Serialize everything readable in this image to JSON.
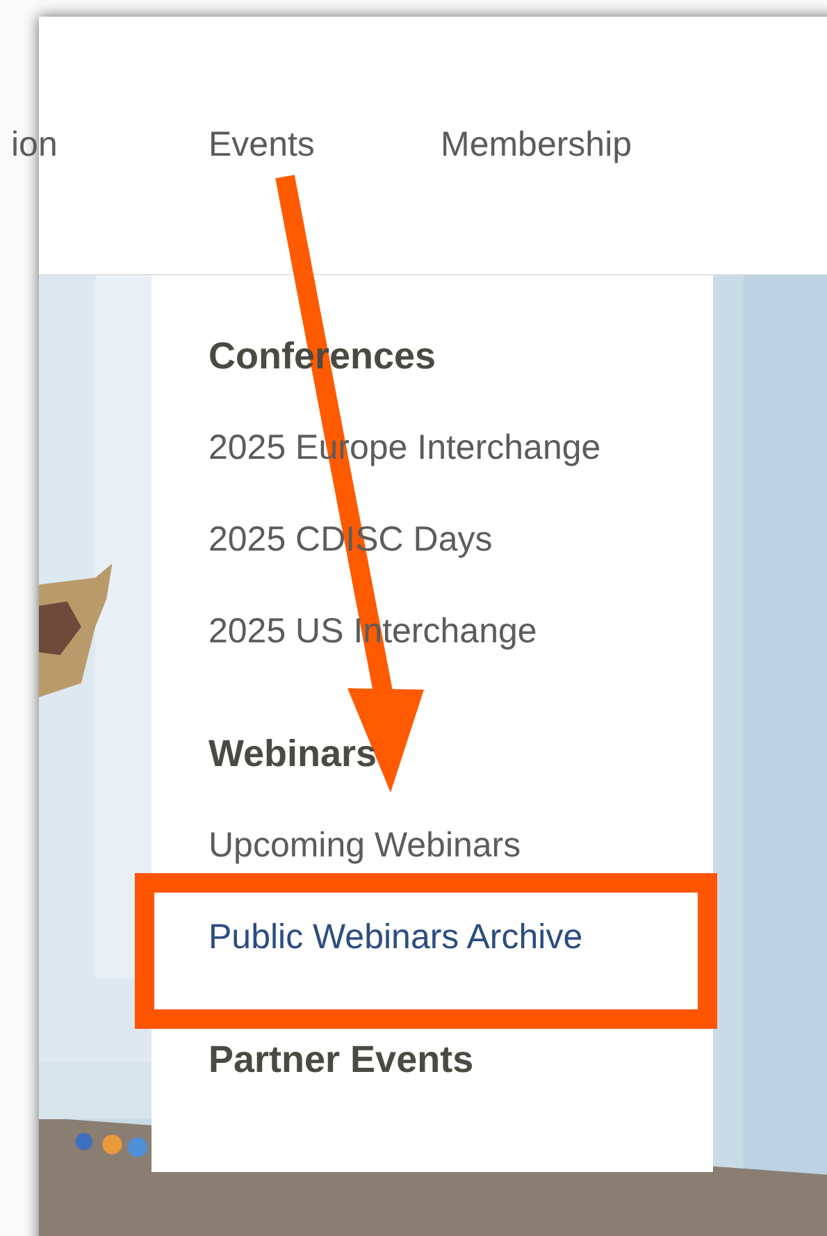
{
  "nav": {
    "items": [
      {
        "label": "ion"
      },
      {
        "label": "Events"
      },
      {
        "label": "Membership"
      }
    ]
  },
  "dropdown": {
    "groups": [
      {
        "heading": "Conferences",
        "links": [
          {
            "label": "2025 Europe Interchange",
            "selected": false
          },
          {
            "label": "2025 CDISC Days",
            "selected": false
          },
          {
            "label": "2025 US Interchange",
            "selected": false
          }
        ]
      },
      {
        "heading": "Webinars",
        "links": [
          {
            "label": "Upcoming Webinars",
            "selected": false
          },
          {
            "label": "Public Webinars Archive",
            "selected": true
          }
        ]
      },
      {
        "heading": "Partner Events"
      }
    ]
  }
}
